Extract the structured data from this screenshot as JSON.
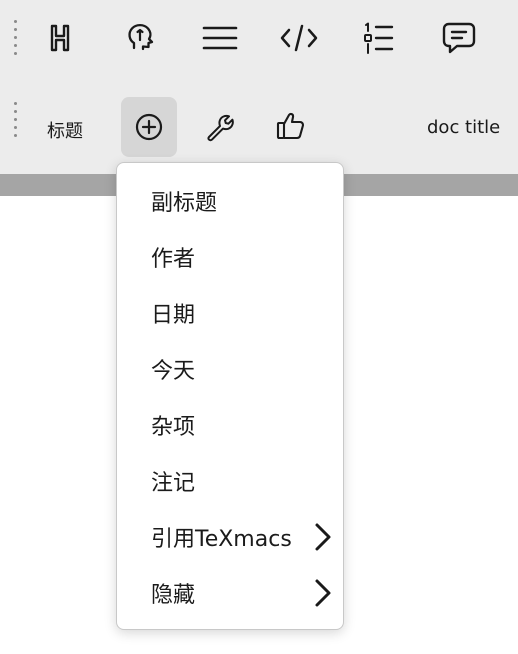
{
  "toolbar_top": {
    "items": [
      {
        "icon": "heading-icon"
      },
      {
        "icon": "lightbulb-icon"
      },
      {
        "icon": "hamburger-lines-icon"
      },
      {
        "icon": "code-tag-icon"
      },
      {
        "icon": "numbered-list-icon"
      },
      {
        "icon": "comment-icon"
      }
    ]
  },
  "toolbar_doc": {
    "title_label": "标题",
    "doc_title_label": "doc title",
    "items": [
      {
        "icon": "plus-circle-icon",
        "active": true
      },
      {
        "icon": "wrench-icon"
      },
      {
        "icon": "thumbs-up-icon"
      }
    ]
  },
  "menu": {
    "items": [
      {
        "label": "副标题",
        "submenu": false
      },
      {
        "label": "作者",
        "submenu": false
      },
      {
        "label": "日期",
        "submenu": false
      },
      {
        "label": "今天",
        "submenu": false
      },
      {
        "label": "杂项",
        "submenu": false
      },
      {
        "label": "注记",
        "submenu": false
      },
      {
        "label": "引用TeXmacs",
        "submenu": true
      },
      {
        "label": "隐藏",
        "submenu": true
      }
    ]
  },
  "colors": {
    "toolbar_bg": "#ececec",
    "active_button_bg": "#d6d6d6",
    "separator_band": "#a5a5a5",
    "menu_bg": "#ffffff"
  }
}
